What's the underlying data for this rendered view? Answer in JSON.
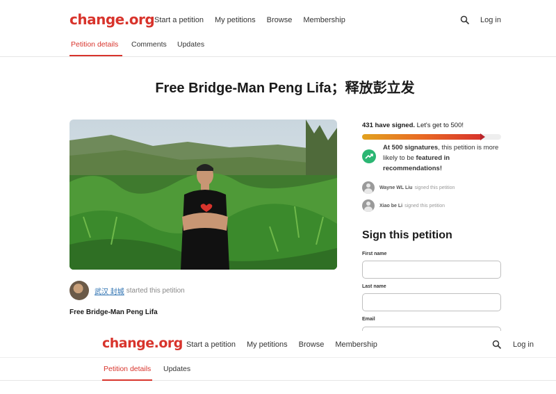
{
  "header": {
    "logo": "change.org",
    "nav": [
      "Start a petition",
      "My petitions",
      "Browse",
      "Membership"
    ],
    "login": "Log in"
  },
  "subnav": {
    "tabs": [
      "Petition details",
      "Comments",
      "Updates"
    ]
  },
  "petition": {
    "title": "Free Bridge-Man Peng Lifa；释放彭立发",
    "starter_name": "武汉 封城",
    "starter_text": "started this petition",
    "body_heading": "Free Bridge-Man Peng Lifa"
  },
  "progress": {
    "signed_bold": "431 have signed.",
    "signed_rest": " Let's get to 500!",
    "signatures": 431,
    "goal": 500
  },
  "milestone": {
    "t1": "At 500 signatures",
    "t2": ", this petition is more likely to be ",
    "t3": "featured in recommendations!"
  },
  "signers": [
    {
      "name": "Wayne WL Liu",
      "text": "signed this petition"
    },
    {
      "name": "Xiao be Li",
      "text": "signed this petition"
    }
  ],
  "sign_form": {
    "title": "Sign this petition",
    "first_name_label": "First name",
    "last_name_label": "Last name",
    "email_label": "Email"
  },
  "header2": {
    "logo": "change.org",
    "nav": [
      "Start a petition",
      "My petitions",
      "Browse",
      "Membership"
    ],
    "login": "Log in"
  },
  "subnav2": {
    "tabs": [
      "Petition details",
      "Updates"
    ]
  },
  "colors": {
    "brand": "#d8342c",
    "milestone_icon": "#2bb673",
    "link": "#2a6fb0"
  }
}
